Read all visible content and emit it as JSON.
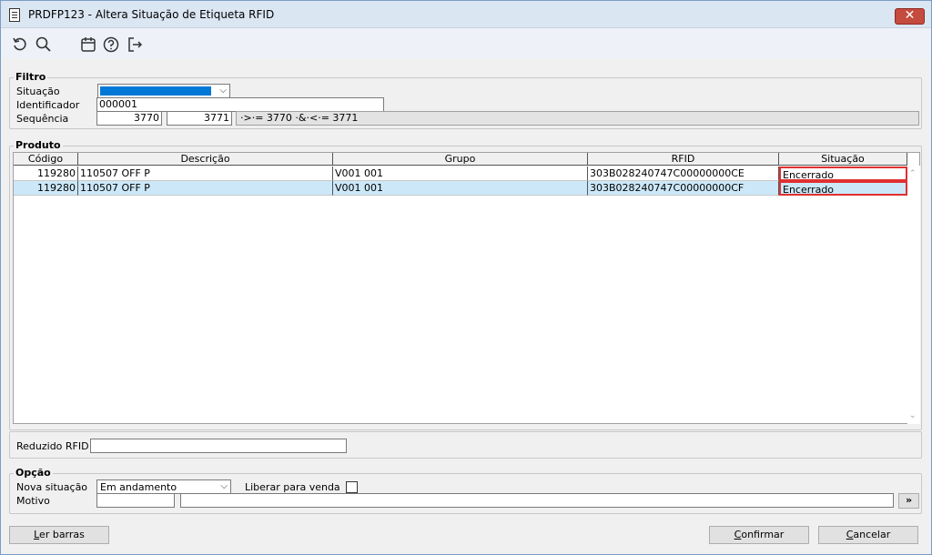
{
  "window": {
    "title": "PRDFP123 - Altera Situação de Etiqueta RFID",
    "close_glyph": "✕"
  },
  "toolbar": {
    "icons": [
      "refresh-icon",
      "search-icon",
      "calendar-icon",
      "help-icon",
      "exit-icon"
    ]
  },
  "filtro": {
    "legend": "Filtro",
    "situacao_label": "Situação",
    "situacao_value": "",
    "identificador_label": "Identificador",
    "identificador_value": "000001",
    "sequencia_label": "Sequência",
    "sequencia_from": "3770",
    "sequencia_to": "3771",
    "sequencia_expr": "·>·= 3770 ·&·<·= 3771"
  },
  "produto": {
    "legend": "Produto",
    "columns": [
      "Código",
      "Descrição",
      "Grupo",
      "RFID",
      "Situação"
    ],
    "rows": [
      {
        "codigo": "119280",
        "descricao": "110507 OFF P",
        "grupo": "V001 001",
        "rfid": "303B028240747C00000000CE",
        "situacao": "Encerrado"
      },
      {
        "codigo": "119280",
        "descricao": "110507 OFF P",
        "grupo": "V001 001",
        "rfid": "303B028240747C00000000CF",
        "situacao": "Encerrado"
      }
    ],
    "reduzido_label": "Reduzido RFID",
    "reduzido_value": ""
  },
  "opcao": {
    "legend": "Opção",
    "nova_situacao_label": "Nova situação",
    "nova_situacao_value": "Em andamento",
    "liberar_label": "Liberar para venda",
    "liberar_checked": false,
    "motivo_label": "Motivo",
    "motivo_code": "",
    "motivo_desc": "",
    "motivo_btn": "»"
  },
  "buttons": {
    "ler_barras_u": "L",
    "ler_barras_rest": "er barras",
    "confirmar_u": "C",
    "confirmar_pre": "",
    "confirmar_rest": "onfirmar",
    "cancelar_u": "C",
    "cancelar_rest": "ancelar"
  },
  "colors": {
    "selection": "#0078d7",
    "row_highlight": "#cce8f8",
    "status_border": "#e03030",
    "close": "#c44b3d"
  }
}
